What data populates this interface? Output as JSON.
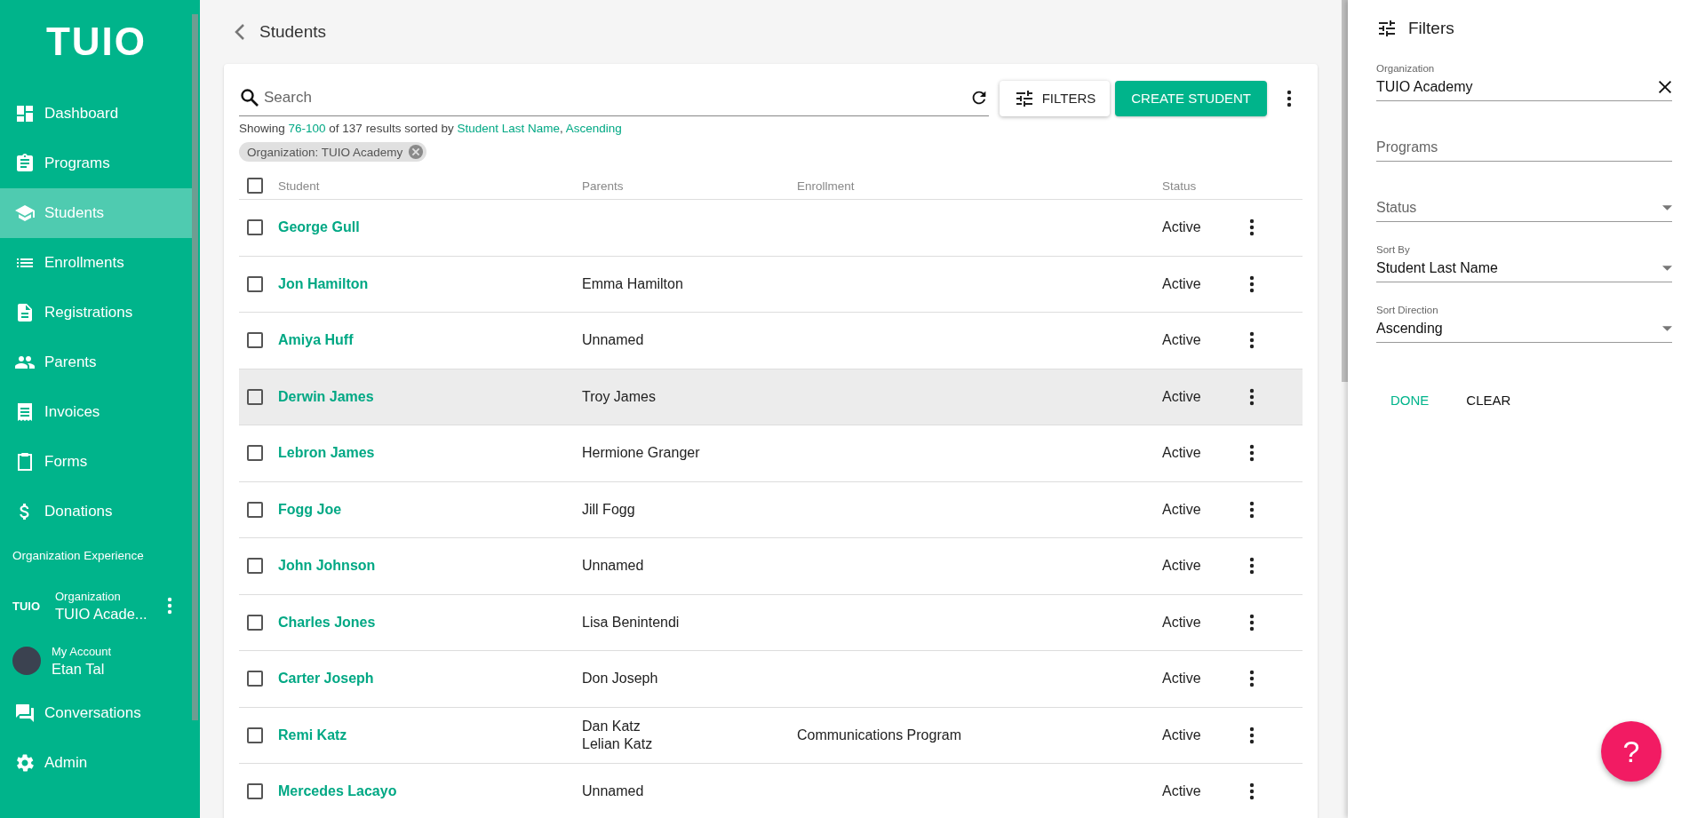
{
  "sidebar": {
    "logo": "TUIO",
    "items": [
      {
        "label": "Dashboard",
        "selected": false
      },
      {
        "label": "Programs",
        "selected": false
      },
      {
        "label": "Students",
        "selected": true
      },
      {
        "label": "Enrollments",
        "selected": false
      },
      {
        "label": "Registrations",
        "selected": false
      },
      {
        "label": "Parents",
        "selected": false
      },
      {
        "label": "Invoices",
        "selected": false
      },
      {
        "label": "Forms",
        "selected": false
      },
      {
        "label": "Donations",
        "selected": false
      }
    ],
    "section_title": "Organization Experience",
    "organization": {
      "logo": "TUIO",
      "label": "Organization",
      "value": "TUIO Acade..."
    },
    "account": {
      "label": "My Account",
      "value": "Etan Tal"
    },
    "bottom_items": [
      {
        "label": "Conversations",
        "selected": false
      },
      {
        "label": "Admin",
        "selected": false
      }
    ]
  },
  "page": {
    "title": "Students"
  },
  "toolbar": {
    "search": {
      "placeholder": "Search"
    },
    "filters_button": "FILTERS",
    "create_button": "CREATE STUDENT"
  },
  "summary": {
    "prefix": "Showing ",
    "range": "76-100",
    "middle": " of 137 results sorted by ",
    "sort_by": "Student Last Name",
    "separator": ", ",
    "direction": "Ascending"
  },
  "chips": [
    {
      "label": "Organization: TUIO Academy"
    }
  ],
  "table": {
    "select_all_checked": false,
    "columns": [
      "Student",
      "Parents",
      "Enrollment",
      "Status"
    ],
    "rows": [
      {
        "student": "George Gull",
        "status": "Active",
        "checked": false,
        "hovered": false
      },
      {
        "student": "Jon Hamilton",
        "parents": [
          "Emma Hamilton"
        ],
        "status": "Active",
        "checked": false,
        "hovered": false
      },
      {
        "student": "Amiya Huff",
        "parents": [
          "Unnamed"
        ],
        "status": "Active",
        "checked": false,
        "hovered": false
      },
      {
        "student": "Derwin James",
        "parents": [
          "Troy James"
        ],
        "status": "Active",
        "checked": false,
        "hovered": true
      },
      {
        "student": "Lebron James",
        "parents": [
          "Hermione Granger"
        ],
        "status": "Active",
        "checked": false,
        "hovered": false
      },
      {
        "student": "Fogg Joe",
        "parents": [
          "Jill Fogg"
        ],
        "status": "Active",
        "checked": false,
        "hovered": false
      },
      {
        "student": "John Johnson",
        "parents": [
          "Unnamed"
        ],
        "status": "Active",
        "checked": false,
        "hovered": false
      },
      {
        "student": "Charles Jones",
        "parents": [
          "Lisa Benintendi"
        ],
        "status": "Active",
        "checked": false,
        "hovered": false
      },
      {
        "student": "Carter Joseph",
        "parents": [
          "Don Joseph"
        ],
        "status": "Active",
        "checked": false,
        "hovered": false
      },
      {
        "student": "Remi Katz",
        "parents": [
          "Dan Katz",
          "Lelian Katz"
        ],
        "enrollment": "Communications Program",
        "status": "Active",
        "checked": false,
        "hovered": false
      },
      {
        "student": "Mercedes Lacayo",
        "parents": [
          "Unnamed"
        ],
        "status": "Active",
        "checked": false,
        "hovered": false
      }
    ]
  },
  "filters_panel": {
    "title": "Filters",
    "fields": [
      {
        "kind": "text",
        "label": "Organization",
        "value": "TUIO Academy",
        "clearable": true
      },
      {
        "kind": "text",
        "placeholder": "Programs"
      },
      {
        "kind": "select",
        "placeholder": "Status"
      },
      {
        "kind": "select",
        "label": "Sort By",
        "value": "Student Last Name"
      },
      {
        "kind": "select",
        "label": "Sort Direction",
        "value": "Ascending"
      }
    ],
    "done_button": "DONE",
    "clear_button": "CLEAR"
  },
  "help_button": "?"
}
